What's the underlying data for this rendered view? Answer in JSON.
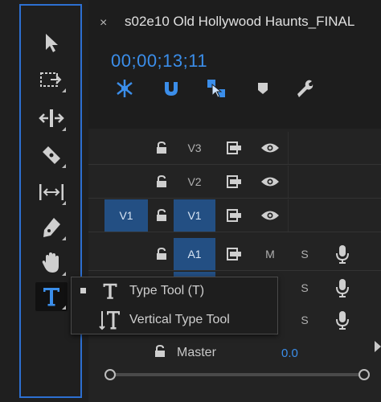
{
  "sequence": {
    "title": "s02e10 Old Hollywood Haunts_FINAL",
    "timecode": "00;00;13;11",
    "close_symbol": "×"
  },
  "colors": {
    "accent": "#3b8eea",
    "track_highlight": "#234f83",
    "panel_border": "#2d6fd1"
  },
  "tools": [
    {
      "name": "selection-tool",
      "icon": "arrow-icon"
    },
    {
      "name": "track-select-tool",
      "icon": "track-select-icon"
    },
    {
      "name": "ripple-edit-tool",
      "icon": "ripple-edit-icon"
    },
    {
      "name": "razor-tool",
      "icon": "razor-icon"
    },
    {
      "name": "slip-tool",
      "icon": "slip-icon"
    },
    {
      "name": "pen-tool",
      "icon": "pen-icon"
    },
    {
      "name": "hand-tool",
      "icon": "hand-icon"
    },
    {
      "name": "type-tool",
      "icon": "type-icon",
      "active": true
    }
  ],
  "header_icons": [
    "snap-icon",
    "magnet-icon",
    "linked-selection-icon",
    "marker-icon",
    "wrench-icon"
  ],
  "tracks": {
    "video": [
      {
        "source": "",
        "label": "V3"
      },
      {
        "source": "",
        "label": "V2"
      },
      {
        "source": "V1",
        "label": "V1"
      }
    ],
    "audio": [
      {
        "source": "",
        "label": "A1",
        "mute": "M",
        "solo": "S"
      },
      {
        "source": "",
        "label": "",
        "mute": "",
        "solo": "S"
      },
      {
        "source": "",
        "label": "",
        "mute": "",
        "solo": "S"
      }
    ]
  },
  "master": {
    "label": "Master",
    "value": "0.0"
  },
  "flyout": {
    "items": [
      {
        "label": "Type Tool (T)",
        "selected": true
      },
      {
        "label": "Vertical Type Tool",
        "selected": false
      }
    ]
  }
}
